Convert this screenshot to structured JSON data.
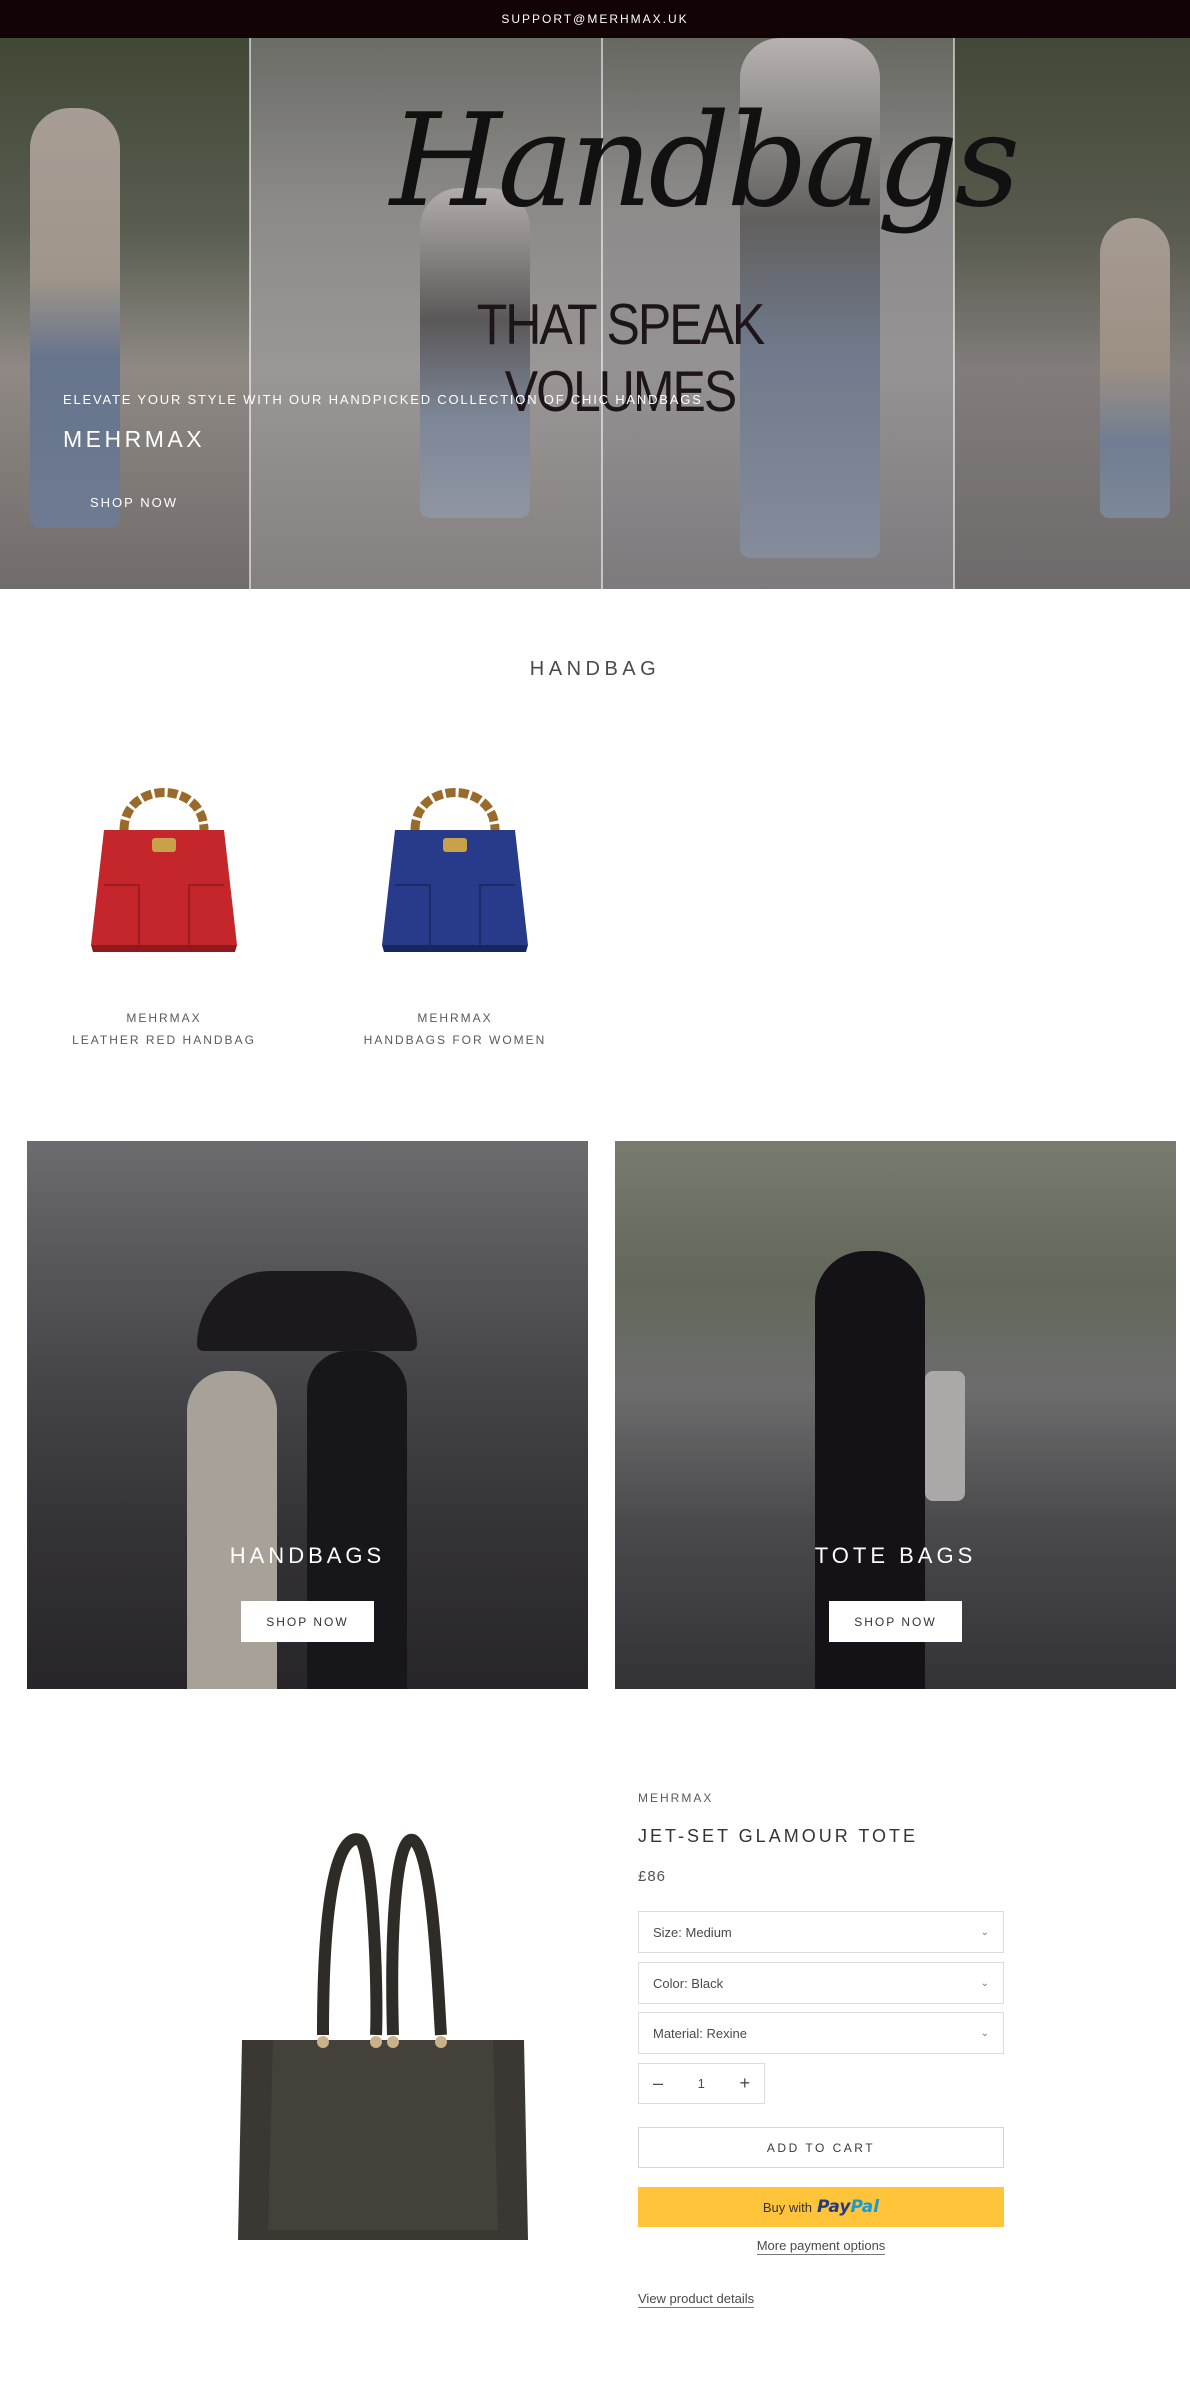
{
  "announcement": {
    "text": "SUPPORT@MERHMAX.UK"
  },
  "hero": {
    "script_title": "Handbags",
    "subtitle": "THAT SPEAK VOLUMES",
    "tagline": "ELEVATE YOUR STYLE WITH OUR HANDPICKED COLLECTION OF CHIC HANDBAGS",
    "brand": "MEHRMAX",
    "cta": "SHOP NOW"
  },
  "collection": {
    "title": "HANDBAG",
    "products": [
      {
        "vendor": "MEHRMAX",
        "name": "LEATHER RED HANDBAG",
        "color": "#c4262b"
      },
      {
        "vendor": "MEHRMAX",
        "name": "HANDBAGS FOR WOMEN",
        "color": "#283a8a"
      }
    ]
  },
  "tiles": [
    {
      "title": "HANDBAGS",
      "button": "SHOP NOW"
    },
    {
      "title": "TOTE BAGS",
      "button": "SHOP NOW"
    }
  ],
  "featured": {
    "vendor": "MEHRMAX",
    "title": "JET-SET GLAMOUR TOTE",
    "price": "£86",
    "options": [
      {
        "label": "Size: Medium"
      },
      {
        "label": "Color: Black"
      },
      {
        "label": "Material: Rexine"
      }
    ],
    "quantity": "1",
    "add_to_cart": "ADD TO CART",
    "paypal_prefix": "Buy with",
    "paypal_brand_1": "Pay",
    "paypal_brand_2": "Pal",
    "more_payment": "More payment options",
    "view_details": "View product details"
  },
  "colors": {
    "announcement_bg": "#120306",
    "paypal_yellow": "#ffc439",
    "tote_color": "#3b3833"
  }
}
